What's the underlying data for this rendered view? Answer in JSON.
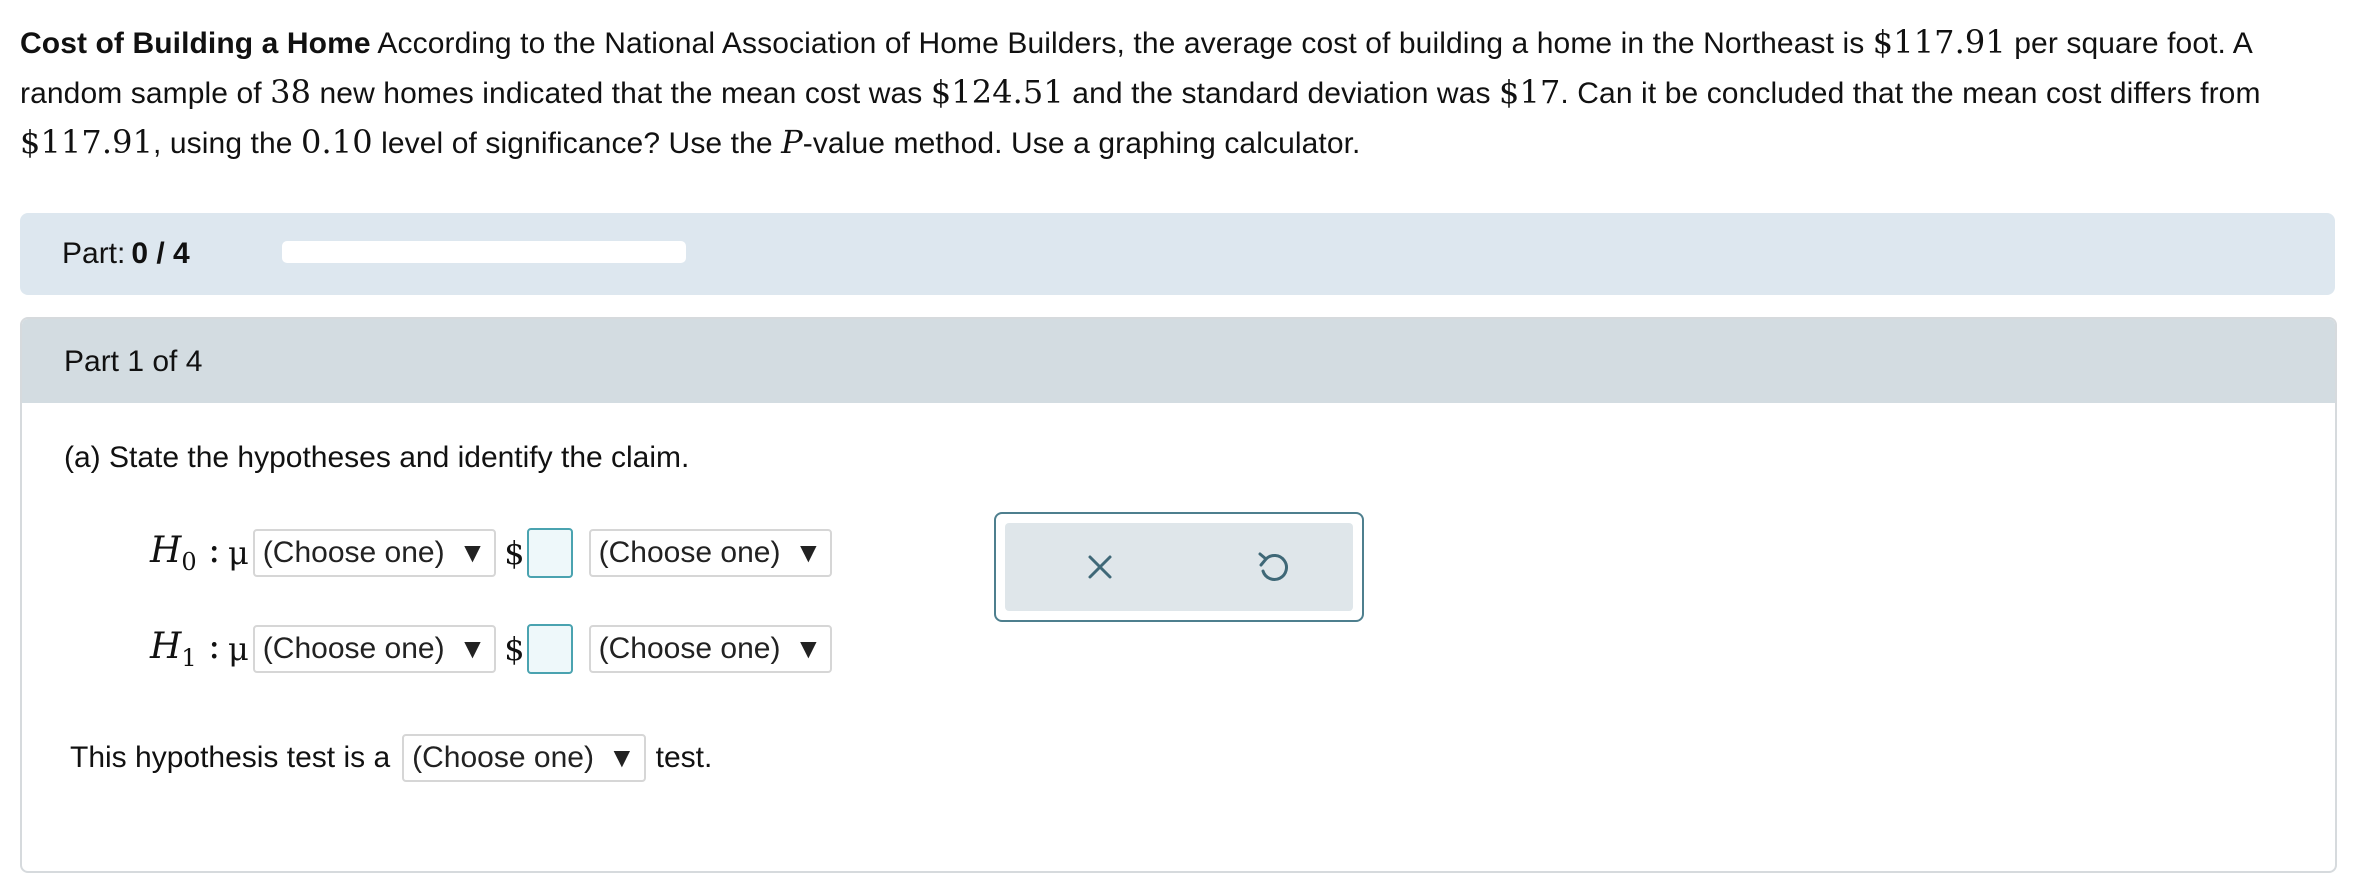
{
  "problem": {
    "title": "Cost of Building a Home",
    "seg1": "According to the National Association of Home Builders, the average cost of building a home in the Northeast is",
    "cost": "$117.91",
    "seg2": "per square foot. A random sample of",
    "n": "38",
    "seg3": "new homes indicated that the mean cost was",
    "mean": "$124.51",
    "seg4": "and the standard deviation was",
    "sd": "$17",
    "seg5": ". Can it be concluded that the mean cost differs from",
    "cost2": "$117.91",
    "seg6": ", using the",
    "alpha": "0.10",
    "seg7": "level of significance? Use the",
    "p": "P",
    "seg8": "-value method. Use a graphing calculator."
  },
  "progress": {
    "label": "Part:",
    "value": "0 / 4",
    "fraction": 0
  },
  "part": {
    "header": "Part 1 of 4",
    "question": "(a) State the hypotheses and identify the claim.",
    "h0": {
      "symbol": "H",
      "sub": "0",
      "colon": ":",
      "mu": "μ",
      "select1": "(Choose one)",
      "dollar": "$",
      "select2": "(Choose one)"
    },
    "h1": {
      "symbol": "H",
      "sub": "1",
      "colon": ":",
      "mu": "μ",
      "select1": "(Choose one)",
      "dollar": "$",
      "select2": "(Choose one)"
    },
    "test_type": {
      "prefix": "This hypothesis test is a",
      "select": "(Choose one)",
      "suffix": "test."
    }
  },
  "arrow_glyph": "▼",
  "icons": {
    "close": "close-icon",
    "undo": "undo-icon"
  },
  "colors": {
    "progress_panel": "#dde7ef",
    "part_header": "#d3dce1",
    "input_border": "#4aa3b0",
    "popover_border": "#4e7f8e"
  }
}
